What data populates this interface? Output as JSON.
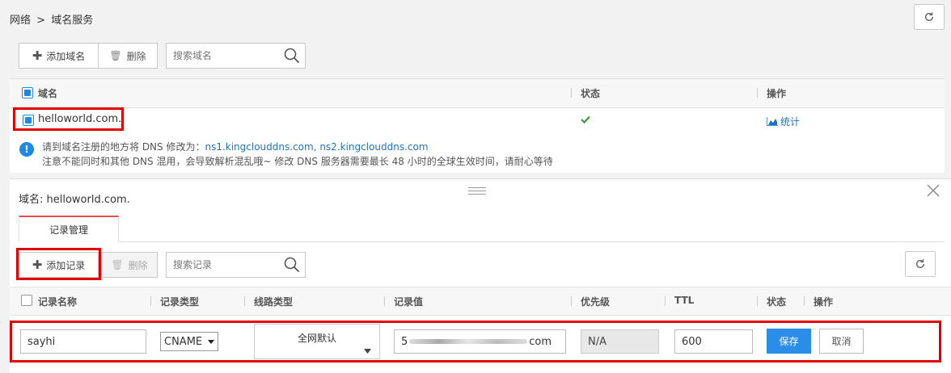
{
  "breadcrumb": {
    "parent": "网络",
    "separator": ">",
    "current": "域名服务"
  },
  "toolbar": {
    "add_label": "添加域名",
    "delete_label": "删除",
    "search_placeholder": "搜索域名"
  },
  "domain_table": {
    "columns": {
      "name": "域名",
      "status": "状态",
      "action": "操作"
    },
    "rows": [
      {
        "name": "helloworld.com.",
        "status": "ok",
        "action_label": "统计"
      }
    ]
  },
  "notice": {
    "line1_prefix": "请到域名注册的地方将 DNS 修改为：",
    "ns_links": "ns1.kingclouddns.com, ns2.kingclouddns.com",
    "line2": "注意不能同时和其他 DNS 混用，会导致解析混乱哦~ 修改 DNS 服务器需要最长 48 小时的全球生效时间，请耐心等待"
  },
  "detail": {
    "title": "域名: helloworld.com.",
    "tab_label": "记录管理",
    "add_record_label": "添加记录",
    "delete_label": "删除",
    "search_placeholder": "搜索记录",
    "columns": {
      "record_name": "记录名称",
      "record_type": "记录类型",
      "line_type": "线路类型",
      "record_value": "记录值",
      "priority": "优先级",
      "ttl": "TTL",
      "status": "状态",
      "action": "操作"
    },
    "edit_row": {
      "name_value": "sayhi",
      "type_value": "CNAME",
      "line_value": "全网默认",
      "value_prefix": "5",
      "value_suffix": "com",
      "priority_value": "N/A",
      "ttl_value": "600",
      "save_label": "保存",
      "cancel_label": "取消"
    }
  },
  "colors": {
    "accent": "#1e88e5",
    "highlight": "#e00000",
    "ok": "#3a9a3a",
    "tab_top": "#e05050"
  }
}
